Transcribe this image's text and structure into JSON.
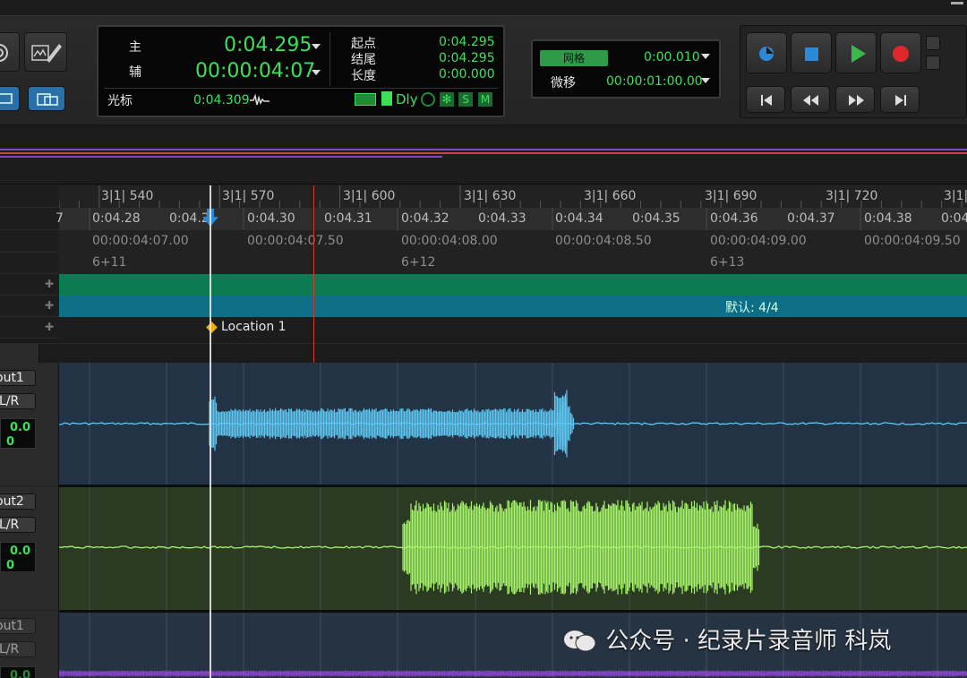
{
  "counter": {
    "main_label": "主",
    "main_value": "0:04.295",
    "sub_label": "辅",
    "sub_value": "00:00:04:07",
    "cursor_label": "光标",
    "cursor_value": "0:04.309",
    "start_label": "起点",
    "start_value": "0:04.295",
    "end_label": "结尾",
    "end_value": "0:04.295",
    "length_label": "长度",
    "length_value": "0:00.000",
    "dly_label": "Dly",
    "s_label": "S",
    "m_label": "M"
  },
  "grid": {
    "grid_label": "网格",
    "grid_value": "0:00.010",
    "nudge_label": "微移",
    "nudge_value": "00:00:01:00.00"
  },
  "colors": {
    "counter_green": "#3ee05a",
    "track1_wave": "#5ec8f2",
    "track2_wave": "#a7f56a",
    "track3_wave": "#8a44c8",
    "tempo_ruler": "#0c7a52",
    "meter_ruler": "#0e6e86",
    "playhead": "#d23a2c",
    "edit_cursor": "#e8e8e8",
    "stop_blue": "#2a8ad8",
    "play_green": "#3ab84a",
    "record_red": "#e0282c"
  },
  "rulers": {
    "bars": [
      "3|1| 540",
      "3|1| 570",
      "3|1| 600",
      "3|1| 630",
      "3|1| 660",
      "3|1| 690",
      "3|1| 720"
    ],
    "bars_cut": "3|1|",
    "minsecs": [
      "0:04.28",
      "0:04.2",
      "0:04.30",
      "0:04.31",
      "0:04.32",
      "0:04.33",
      "0:04.34",
      "0:04.35",
      "0:04.36",
      "0:04.37",
      "0:04.38",
      "0:04"
    ],
    "minsecs_cut_left": "7",
    "timecode": [
      "00:00:04:07.00",
      "00:00:04:07.50",
      "00:00:04:08.00",
      "00:00:04:08.50",
      "00:00:04:09.00",
      "00:00:04:09.50"
    ],
    "feet": [
      "6+11",
      "6+12",
      "6+13"
    ],
    "meter_text": "默认: 4/4",
    "marker_text": "Location 1"
  },
  "tracks": [
    {
      "name": "out1",
      "io": "L/R",
      "vol": "0.0",
      "pan": "0"
    },
    {
      "name": "out2",
      "io": "L/R",
      "vol": "0.0",
      "pan": "0"
    },
    {
      "name": "out1",
      "io": "L/R",
      "vol": "0.0",
      "pan": ""
    }
  ],
  "watermark": "公众号 · 纪录片录音师 科岚",
  "icons": {
    "stop": "stop-icon",
    "play": "play-icon",
    "record": "record-icon",
    "loop": "loop-icon",
    "rewind": "rewind-icon",
    "fast_forward": "fast-forward-icon",
    "go_to_start": "go-to-start-icon",
    "go_to_end": "go-to-end-icon"
  }
}
